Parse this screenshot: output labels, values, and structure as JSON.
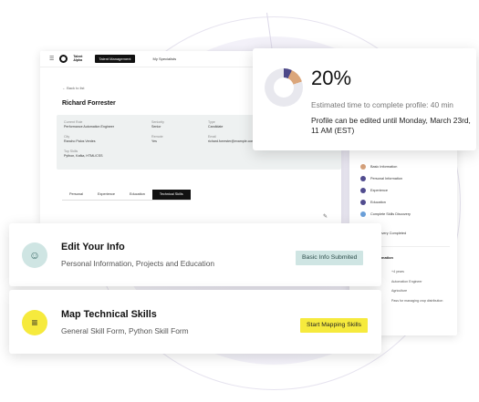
{
  "app": {
    "logo_text": "Talent Alpha",
    "nav_active": "Talent Management",
    "nav_link": "My Specialists",
    "back_link": "← Back to list",
    "person_name": "Richard Forrester",
    "fields": [
      {
        "key": "Current Role",
        "value": "Performance Automation Engineer"
      },
      {
        "key": "Seniority",
        "value": "Senior"
      },
      {
        "key": "Type",
        "value": "Candidate"
      },
      {
        "key": "City",
        "value": "Rancho Palos Verdes"
      },
      {
        "key": "Remote",
        "value": "Yes"
      },
      {
        "key": "Email",
        "value": "richard.forrester@example.com"
      },
      {
        "key": "Top Skills",
        "value": "Python, Kafka, HTML/CSS"
      }
    ],
    "tabs": [
      "Personal",
      "Experience",
      "Education",
      "Technical Skills"
    ],
    "active_tab_index": 3
  },
  "sidebar": {
    "items": [
      {
        "label": "Basic Information",
        "color": "#d4a07a"
      },
      {
        "label": "Personal Information",
        "color": "#514c8f"
      },
      {
        "label": "Experience",
        "color": "#514c8f"
      },
      {
        "label": "Education",
        "color": "#514c8f"
      },
      {
        "label": "Complete Skills Discovery",
        "color": "#6a9fd8"
      }
    ],
    "discovery_done": "Discovery Completed",
    "info_heading": "Information",
    "info_rows": [
      {
        "key": "",
        "value": "+4 years"
      },
      {
        "key": "",
        "value": "Automation Engineer"
      },
      {
        "key": "",
        "value": "Agriculture"
      },
      {
        "key": "",
        "value": "Pass for managing crop distribution"
      }
    ]
  },
  "popup": {
    "percent": "20%",
    "estimated": "Estimated time to complete profile: 40 min",
    "edit_until": "Profile can be edited until Monday, March 23rd, 11 AM (EST)"
  },
  "cards": {
    "edit_info": {
      "title": "Edit Your Info",
      "subtitle": "Personal Information, Projects and Education",
      "button": "Basic Info Submited",
      "icon": "smiley-icon"
    },
    "map_skills": {
      "title": "Map Technical Skills",
      "subtitle": "General Skill Form, Python Skill Form",
      "button": "Start Mapping Skills",
      "icon": "list-icon"
    }
  },
  "colors": {
    "teal_chip": "#cfe5e3",
    "yellow_chip": "#f6ea3d",
    "indigo": "#4d4888",
    "tan": "#dba67b"
  }
}
